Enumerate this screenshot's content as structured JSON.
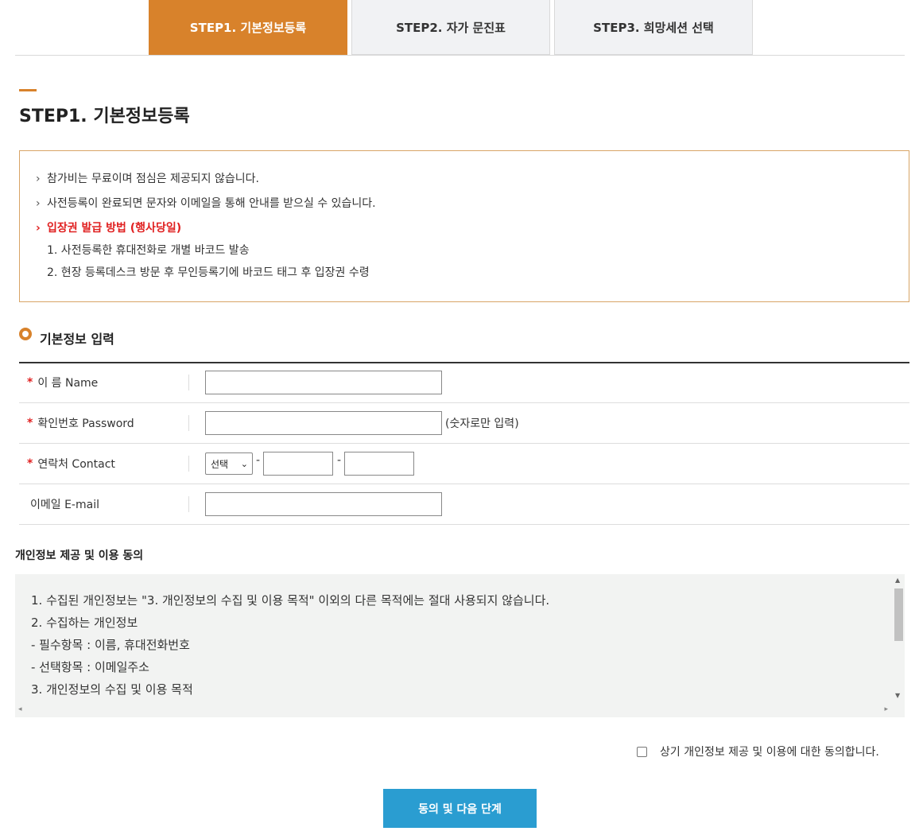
{
  "tabs": [
    {
      "label": "STEP1. 기본정보등록",
      "active": true
    },
    {
      "label": "STEP2. 자가 문진표",
      "active": false
    },
    {
      "label": "STEP3. 희망세션 선택",
      "active": false
    }
  ],
  "page_title": "STEP1. 기본정보등록",
  "notice": {
    "arrow": "›",
    "lines": [
      "참가비는 무료이며 점심은 제공되지 않습니다.",
      "사전등록이 완료되면 문자와 이메일을 통해 안내를 받으실 수 있습니다.",
      "입장권 발급 방법 (행사당일)"
    ],
    "sub_lines": [
      "1. 사전등록한 휴대전화로 개별 바코드 발송",
      "2. 현장 등록데스크 방문 후 무인등록기에 바코드 태그 후 입장권 수령"
    ]
  },
  "section_title": "기본정보 입력",
  "form": {
    "required_mark": "*",
    "name_label": "이 름 Name",
    "password_label": "확인번호 Password",
    "password_hint": "(숫자로만 입력)",
    "contact_label": "연락처 Contact",
    "contact_select": "선택",
    "contact_dash": "-",
    "email_label": "이메일 E-mail"
  },
  "privacy": {
    "title": "개인정보 제공 및 이용 동의",
    "lines": [
      "1. 수집된 개인정보는 \"3. 개인정보의 수집 및 이용 목적\" 이외의 다른 목적에는 절대 사용되지 않습니다.",
      "2. 수집하는 개인정보",
      "  - 필수항목 : 이름, 휴대전화번호",
      "  - 선택항목 : 이메일주소",
      "3. 개인정보의 수집 및 이용 목적"
    ]
  },
  "agree_text": "상기 개인정보 제공 및 이용에 대한 동의합니다.",
  "next_button": "동의 및 다음 단계",
  "colors": {
    "accent": "#d8822b",
    "button": "#2a9dd1",
    "required": "#e02020"
  }
}
